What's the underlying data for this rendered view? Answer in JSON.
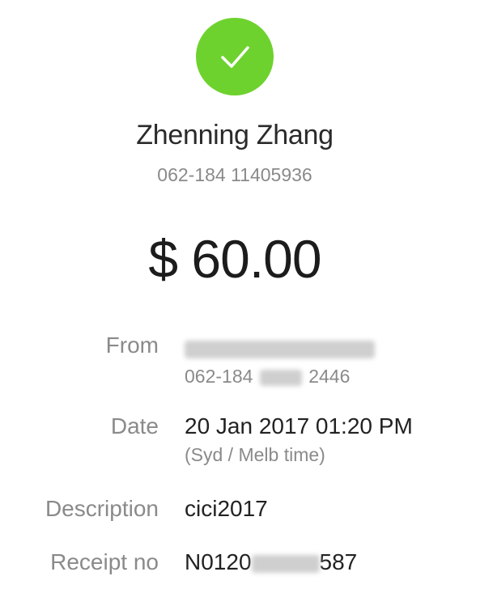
{
  "status": {
    "icon": "check-icon",
    "color": "#6ed22e"
  },
  "payee": {
    "name": "Zhenning Zhang",
    "account": "062-184 11405936"
  },
  "amount": "$ 60.00",
  "details": {
    "from": {
      "label": "From",
      "account_prefix": "062-184",
      "account_suffix": "2446"
    },
    "date": {
      "label": "Date",
      "value": "20 Jan 2017 01:20 PM",
      "timezone": "(Syd / Melb time)"
    },
    "description": {
      "label": "Description",
      "value": "cici2017"
    },
    "receipt": {
      "label": "Receipt no",
      "prefix": "N0120",
      "suffix": "587"
    }
  }
}
